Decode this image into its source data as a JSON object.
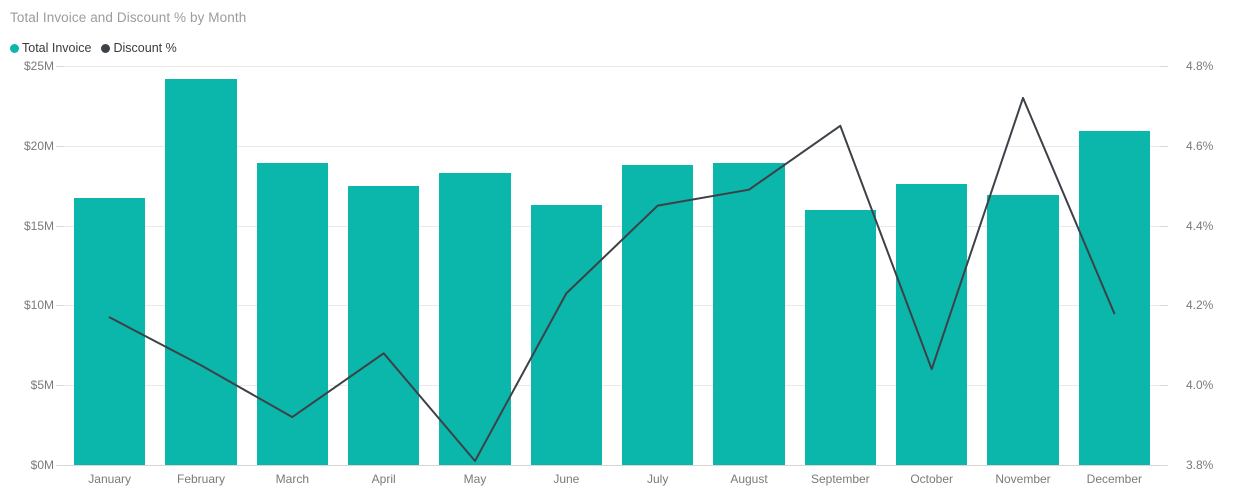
{
  "header": {
    "title": "Total Invoice and Discount % by Month"
  },
  "legend": {
    "items": [
      {
        "label": "Total Invoice",
        "color": "#0bb6ab",
        "marker": "filled-circle"
      },
      {
        "label": "Discount %",
        "color": "#3c4247",
        "marker": "filled-circle"
      }
    ]
  },
  "axes": {
    "left_ticks": [
      "$25M",
      "$20M",
      "$15M",
      "$10M",
      "$5M",
      "$0M"
    ],
    "right_ticks": [
      "4.8%",
      "4.6%",
      "4.4%",
      "4.2%",
      "4.0%",
      "3.8%"
    ]
  },
  "chart_data": {
    "type": "bar",
    "title": "Total Invoice and Discount % by Month",
    "xlabel": "",
    "ylabel": "",
    "grid": true,
    "legend_position": "top-left",
    "categories": [
      "January",
      "February",
      "March",
      "April",
      "May",
      "June",
      "July",
      "August",
      "September",
      "October",
      "November",
      "December"
    ],
    "series": [
      {
        "name": "Total Invoice",
        "type": "bar",
        "axis": "left",
        "color": "#0bb6ab",
        "unit": "$M",
        "values": [
          16.7,
          24.2,
          18.9,
          17.5,
          18.3,
          16.3,
          18.8,
          18.9,
          16.0,
          17.6,
          16.9,
          20.9
        ],
        "ylim": [
          0,
          25
        ],
        "ytick_values": [
          25,
          20,
          15,
          10,
          5,
          0
        ],
        "ytick_labels": [
          "$25M",
          "$20M",
          "$15M",
          "$10M",
          "$5M",
          "$0M"
        ]
      },
      {
        "name": "Discount %",
        "type": "line",
        "axis": "right",
        "color": "#3c4247",
        "unit": "%",
        "values": [
          4.17,
          4.05,
          3.92,
          4.08,
          3.81,
          4.23,
          4.45,
          4.49,
          4.65,
          4.04,
          4.72,
          4.18
        ],
        "ylim": [
          3.8,
          4.8
        ],
        "ytick_values": [
          4.8,
          4.6,
          4.4,
          4.2,
          4.0,
          3.8
        ],
        "ytick_labels": [
          "4.8%",
          "4.6%",
          "4.4%",
          "4.2%",
          "4.0%",
          "3.8%"
        ]
      }
    ]
  }
}
